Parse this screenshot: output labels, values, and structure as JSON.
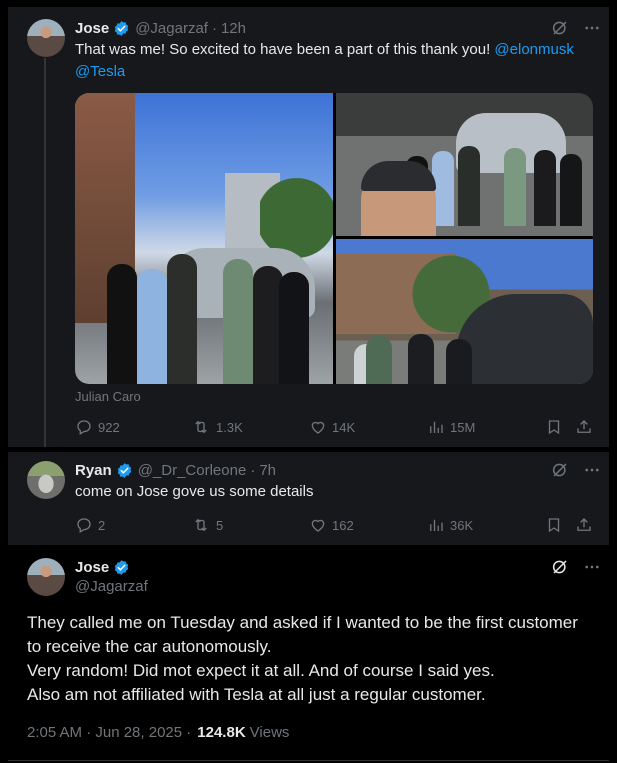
{
  "tweet1": {
    "name": "Jose",
    "handle": "@Jagarzaf",
    "time": "12h",
    "text": "That was me! So excited to have been a part of this thank you!",
    "mention1": "@elonmusk",
    "mention2": "@Tesla",
    "media_credit": "Julian Caro",
    "stats": {
      "replies": "922",
      "reposts": "1.3K",
      "likes": "14K",
      "views": "15M"
    }
  },
  "tweet2": {
    "name": "Ryan",
    "handle": "@_Dr_Corleone",
    "time": "7h",
    "text": "come on Jose gove us some details",
    "stats": {
      "replies": "2",
      "reposts": "5",
      "likes": "162",
      "views": "36K"
    }
  },
  "main_tweet": {
    "name": "Jose",
    "handle": "@Jagarzaf",
    "lines": [
      "They called me on Tuesday and asked if I wanted to be the first customer",
      "to receive the car autonomously.",
      "Very random! Did mot expect it at all. And of course I said yes.",
      "Also am not affiliated with Tesla at all just a regular customer."
    ],
    "timestamp": "2:05 AM · Jun 28, 2025 ·",
    "views_count": "124.8K",
    "views_label": "Views"
  },
  "icons": {
    "verified": "verified-badge-icon",
    "grok": "grok-icon",
    "more": "more-icon",
    "reply": "reply-icon",
    "repost": "repost-icon",
    "like": "like-icon",
    "views": "views-icon",
    "bookmark": "bookmark-icon",
    "share": "share-icon"
  },
  "colors": {
    "accent": "#1d9bf0",
    "muted": "#71767b",
    "text": "#e7e9ea",
    "background": "#000000",
    "band": "#16181c"
  }
}
